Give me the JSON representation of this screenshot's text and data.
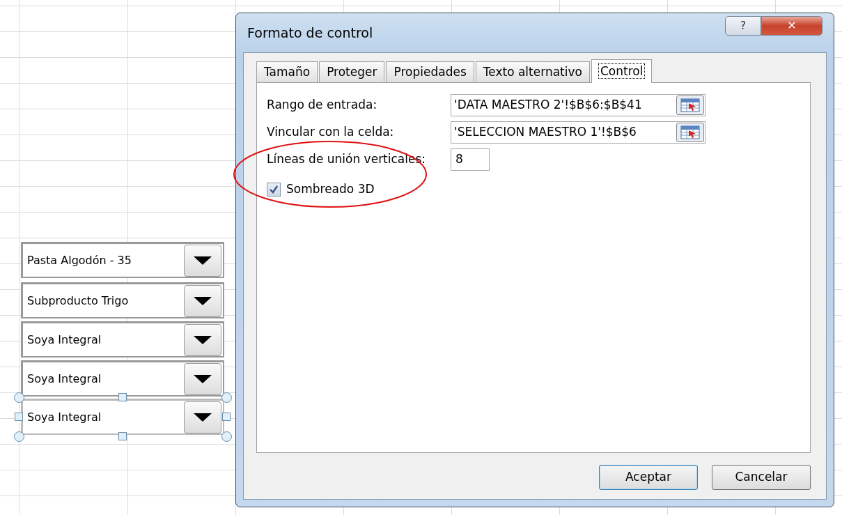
{
  "sheet": {
    "combos": [
      {
        "value": "Pasta Algodón - 35",
        "selected": false
      },
      {
        "value": "Subproducto Trigo",
        "selected": false
      },
      {
        "value": "Soya Integral",
        "selected": false
      },
      {
        "value": "Soya Integral",
        "selected": false
      },
      {
        "value": "Soya Integral",
        "selected": true
      }
    ]
  },
  "dialog": {
    "title": "Formato de control",
    "help_button": "?",
    "close_button": "✕",
    "tabs": [
      {
        "label": "Tamaño",
        "selected": false
      },
      {
        "label": "Proteger",
        "selected": false
      },
      {
        "label": "Propiedades",
        "selected": false
      },
      {
        "label": "Texto alternativo",
        "selected": false
      },
      {
        "label": "Control",
        "selected": true
      }
    ],
    "fields": [
      {
        "kind": "range",
        "label": "Rango de entrada:",
        "value": "'DATA MAESTRO 2'!$B$6:$B$41"
      },
      {
        "kind": "range",
        "label": "Vincular con la celda:",
        "value": "'SELECCION MAESTRO 1'!$B$6"
      },
      {
        "kind": "number",
        "label": "Líneas de unión verticales:",
        "value": "8"
      },
      {
        "kind": "checkbox",
        "label": "Sombreado 3D",
        "checked": true
      }
    ],
    "buttons": [
      {
        "label": "Aceptar",
        "default": true
      },
      {
        "label": "Cancelar",
        "default": false
      }
    ]
  }
}
